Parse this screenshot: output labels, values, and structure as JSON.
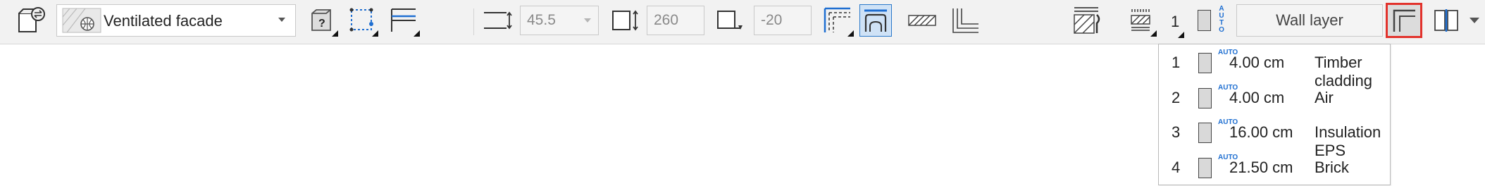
{
  "toolbar": {
    "wall_type": "Ventilated facade",
    "height_value": "45.5",
    "thickness_value": "260",
    "offset_value": "-20",
    "layer_number": "1",
    "auto_label": "AUTO",
    "layer_button_label": "Wall layer"
  },
  "colors": {
    "highlight": "#e2322c",
    "accent_blue": "#1f6fd1",
    "toolbar_bg": "#f2f2f2"
  },
  "layers": [
    {
      "num": "1",
      "auto": "AUTO",
      "thickness": "4.00 cm",
      "name": "Timber cladding"
    },
    {
      "num": "2",
      "auto": "AUTO",
      "thickness": "4.00 cm",
      "name": "Air"
    },
    {
      "num": "3",
      "auto": "AUTO",
      "thickness": "16.00 cm",
      "name": "Insulation EPS"
    },
    {
      "num": "4",
      "auto": "AUTO",
      "thickness": "21.50 cm",
      "name": "Brick"
    }
  ]
}
